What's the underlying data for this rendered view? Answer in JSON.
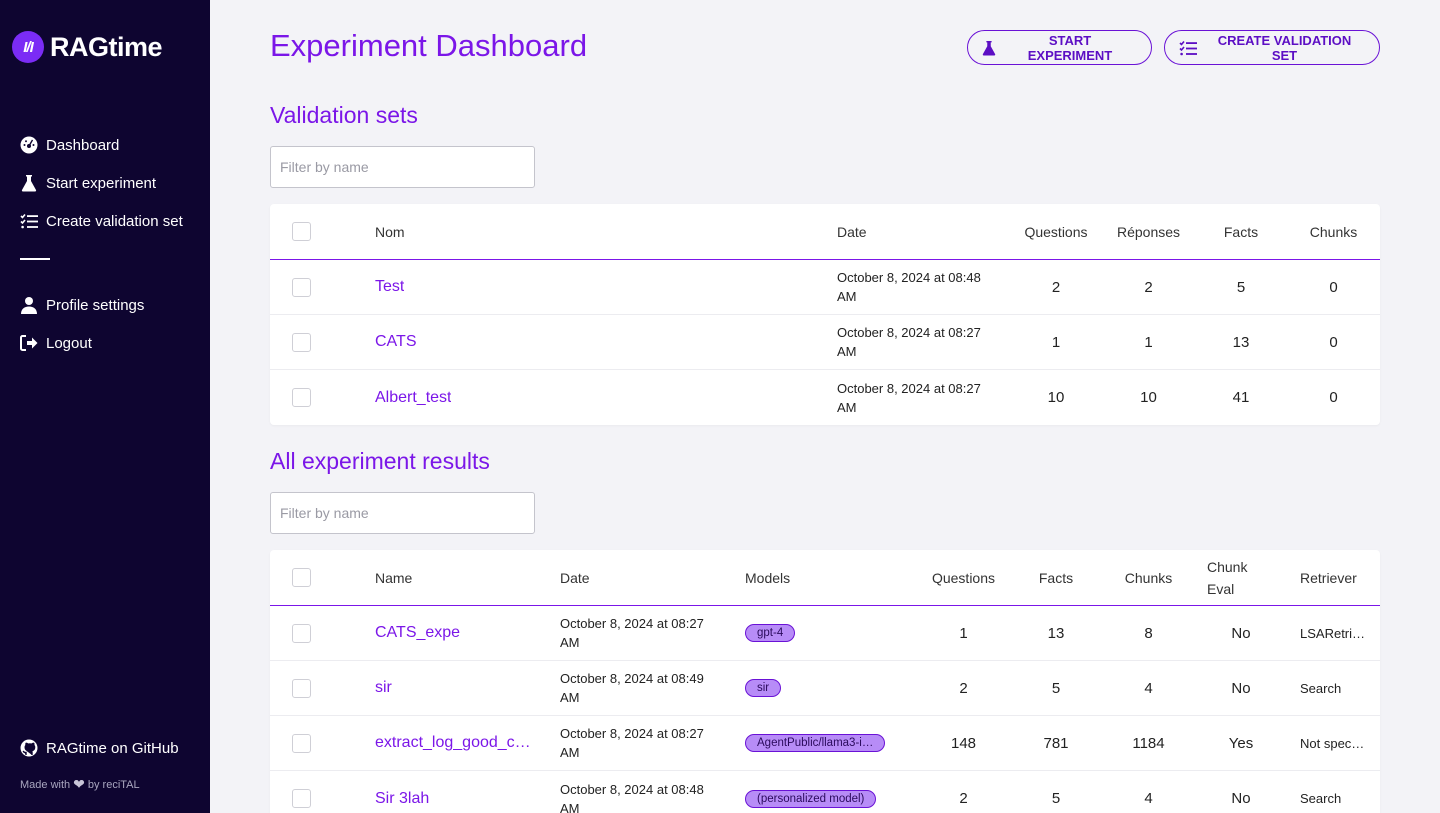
{
  "app": {
    "name": "RAGtime",
    "logo_text": "I/I"
  },
  "sidebar": {
    "items": [
      {
        "label": "Dashboard",
        "icon": "dashboard-icon"
      },
      {
        "label": "Start experiment",
        "icon": "flask-icon"
      },
      {
        "label": "Create validation set",
        "icon": "checklist-icon"
      }
    ],
    "account_items": [
      {
        "label": "Profile settings",
        "icon": "user-icon"
      },
      {
        "label": "Logout",
        "icon": "logout-icon"
      }
    ],
    "github_label": "RAGtime on GitHub",
    "made_with_prefix": "Made with",
    "made_with_suffix": "by reciTAL"
  },
  "header": {
    "title": "Experiment Dashboard",
    "start_button": "START EXPERIMENT",
    "create_button": "CREATE VALIDATION SET"
  },
  "validation_sets": {
    "title": "Validation sets",
    "filter_placeholder": "Filter by name",
    "columns": [
      "Nom",
      "Date",
      "Questions",
      "Réponses",
      "Facts",
      "Chunks"
    ],
    "rows": [
      {
        "name": "Test",
        "date": "October 8, 2024 at 08:48 AM",
        "questions": "2",
        "answers": "2",
        "facts": "5",
        "chunks": "0"
      },
      {
        "name": "CATS",
        "date": "October 8, 2024 at 08:27 AM",
        "questions": "1",
        "answers": "1",
        "facts": "13",
        "chunks": "0"
      },
      {
        "name": "Albert_test",
        "date": "October 8, 2024 at 08:27 AM",
        "questions": "10",
        "answers": "10",
        "facts": "41",
        "chunks": "0"
      }
    ]
  },
  "experiments": {
    "title": "All experiment results",
    "filter_placeholder": "Filter by name",
    "columns": [
      "Name",
      "Date",
      "Models",
      "Questions",
      "Facts",
      "Chunks",
      "Chunk Eval",
      "Retriever"
    ],
    "rows": [
      {
        "name": "CATS_expe",
        "date": "October 8, 2024 at 08:27 AM",
        "model": "gpt-4",
        "questions": "1",
        "facts": "13",
        "chunks": "8",
        "chunk_eval": "No",
        "retriever": "LSARetri…"
      },
      {
        "name": "sir",
        "date": "October 8, 2024 at 08:49 AM",
        "model": "sir",
        "questions": "2",
        "facts": "5",
        "chunks": "4",
        "chunk_eval": "No",
        "retriever": "Search"
      },
      {
        "name": "extract_log_good_c…",
        "date": "October 8, 2024 at 08:27 AM",
        "model": "AgentPublic/llama3-i…",
        "questions": "148",
        "facts": "781",
        "chunks": "1184",
        "chunk_eval": "Yes",
        "retriever": "Not spec…"
      },
      {
        "name": "Sir 3lah",
        "date": "October 8, 2024 at 08:48 AM",
        "model": "(personalized model)",
        "questions": "2",
        "facts": "5",
        "chunks": "4",
        "chunk_eval": "No",
        "retriever": "Search"
      }
    ]
  },
  "colors": {
    "accent": "#7b16e8",
    "sidebar_bg": "#0e0530",
    "pill_bg": "#b78cf7"
  }
}
